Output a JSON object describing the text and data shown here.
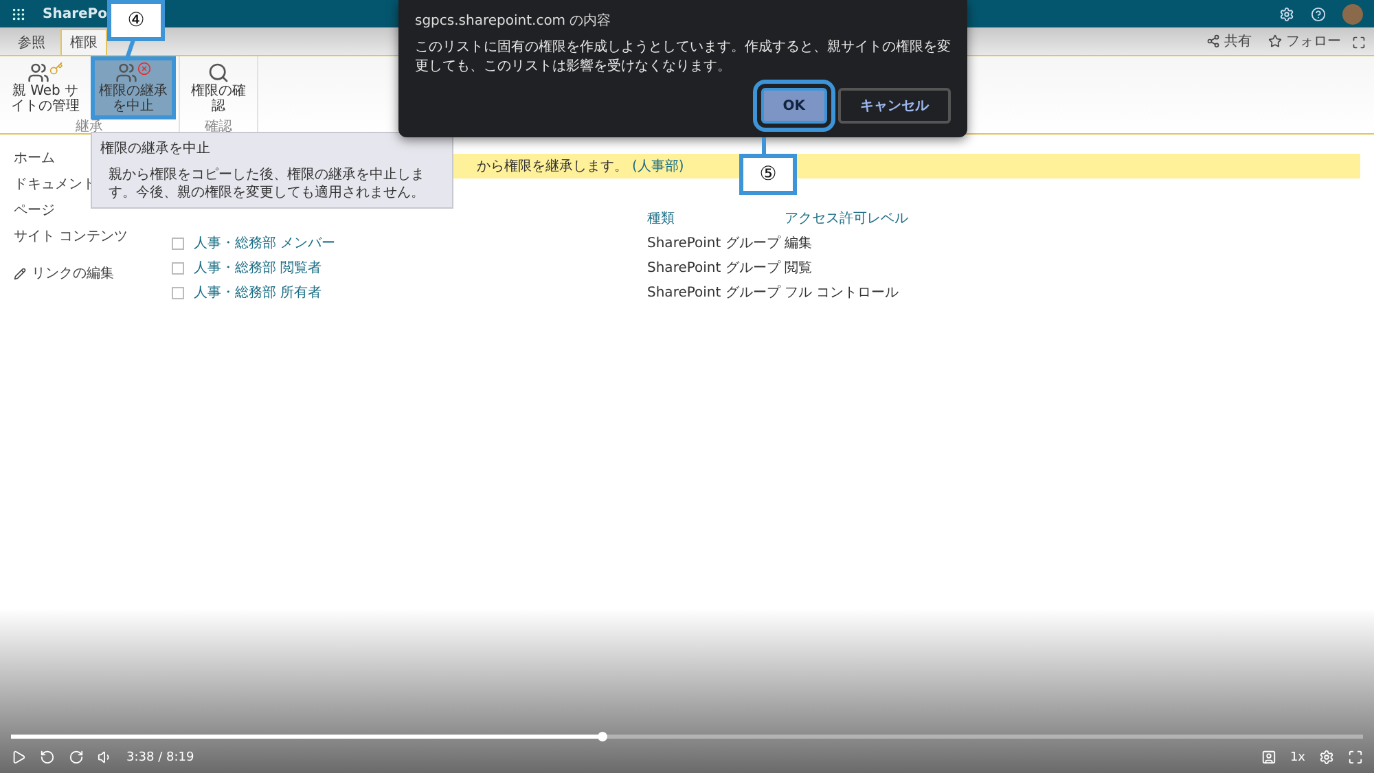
{
  "top_bar": {
    "app_name": "SharePo"
  },
  "ribbon": {
    "tabs": [
      {
        "label": "参照",
        "selected": false
      },
      {
        "label": "権限",
        "selected": true
      }
    ],
    "actions": [
      {
        "label": "共有",
        "kind": "share"
      },
      {
        "label": "フォロー",
        "kind": "follow"
      }
    ],
    "groups": [
      {
        "label": "継承",
        "buttons": [
          {
            "label": "親 Web サイトの管理",
            "kind": "parent",
            "highlighted": false
          },
          {
            "label": "権限の継承を中止",
            "kind": "stop",
            "highlighted": true
          }
        ]
      },
      {
        "label": "確認",
        "buttons": [
          {
            "label": "権限の確認",
            "kind": "check",
            "highlighted": false
          }
        ]
      }
    ]
  },
  "tooltip": {
    "title": "権限の継承を中止",
    "body": "親から権限をコピーした後、権限の継承を中止します。今後、親の権限を変更しても適用されません。"
  },
  "nav": [
    {
      "label": "ホーム",
      "kind": "link"
    },
    {
      "label": "ドキュメント",
      "kind": "link"
    },
    {
      "label": "ページ",
      "kind": "link"
    },
    {
      "label": "サイト コンテンツ",
      "kind": "link"
    },
    {
      "label": "リンクの編集",
      "kind": "edit"
    }
  ],
  "banner": {
    "text": "から権限を継承します。",
    "link": "(人事部)"
  },
  "table": {
    "columns": [
      {
        "label": "種類"
      },
      {
        "label": "アクセス許可レベル"
      }
    ],
    "rows": [
      {
        "name": "人事・総務部 メンバー",
        "type": "SharePoint グループ",
        "permission": "編集",
        "checked": false
      },
      {
        "name": "人事・総務部 閲覧者",
        "type": "SharePoint グループ",
        "permission": "閲覧",
        "checked": false
      },
      {
        "name": "人事・総務部 所有者",
        "type": "SharePoint グループ",
        "permission": "フル コントロール",
        "checked": false
      }
    ]
  },
  "dialog": {
    "title": "sgpcs.sharepoint.com の内容",
    "message": "このリストに固有の権限を作成しようとしています。作成すると、親サイトの権限を変更しても、このリストは影響を受けなくなります。",
    "buttons": [
      {
        "label": "OK",
        "kind": "primary",
        "highlighted": true
      },
      {
        "label": "キャンセル",
        "kind": "secondary",
        "highlighted": false
      }
    ]
  },
  "callouts": [
    {
      "label": "④"
    },
    {
      "label": "⑤"
    }
  ],
  "video": {
    "progress": {
      "level": 0.437
    },
    "time": "3:38 / 8:19",
    "speed": "1x"
  }
}
